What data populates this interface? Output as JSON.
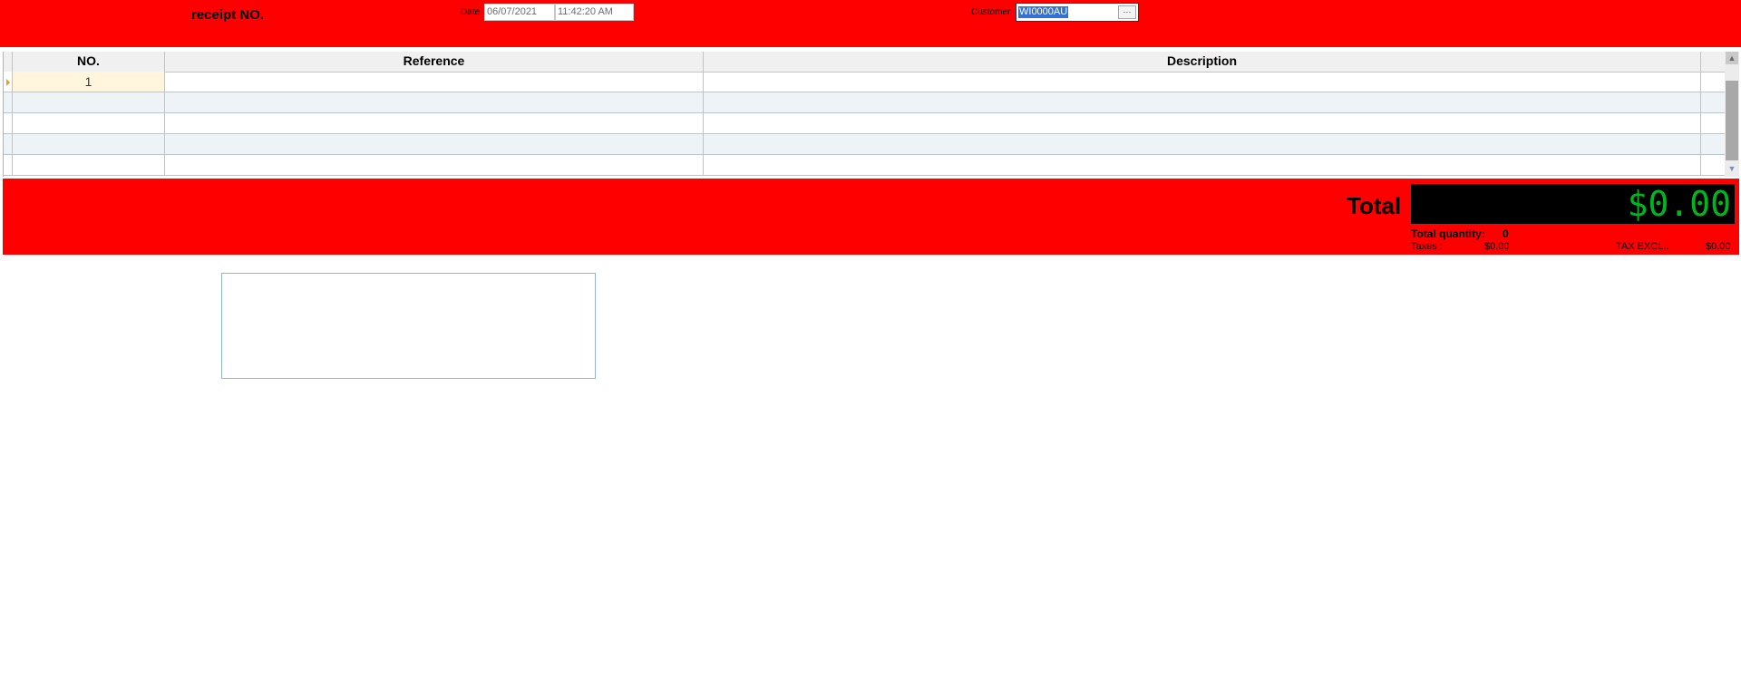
{
  "header": {
    "receipt_label": "receipt NO.",
    "date_label": "Date",
    "date_value": "06/07/2021",
    "time_value": "11:42:20 AM",
    "customer_label": "Customer",
    "customer_value": "WI0000AU",
    "lookup_label": "···"
  },
  "grid": {
    "columns": [
      "NO.",
      "Reference",
      "Description"
    ],
    "rows": [
      [
        "1",
        "",
        ""
      ],
      [
        "",
        "",
        ""
      ],
      [
        "",
        "",
        ""
      ],
      [
        "",
        "",
        ""
      ],
      [
        "",
        "",
        ""
      ]
    ]
  },
  "totals": {
    "total_label": "Total",
    "total_amount": "$0.00",
    "total_quantity_label": "Total quantity:",
    "total_quantity_value": "0",
    "taxes_label": "Taxes :",
    "taxes_value": "$0.00",
    "tax_excl_label": "TAX EXCL.:",
    "tax_excl_value": "$0.00"
  },
  "colors": {
    "panel_background": "#ff0000",
    "total_display_background": "#000000",
    "total_amount_color": "#00b620",
    "selection_highlight": "#3271d6"
  }
}
